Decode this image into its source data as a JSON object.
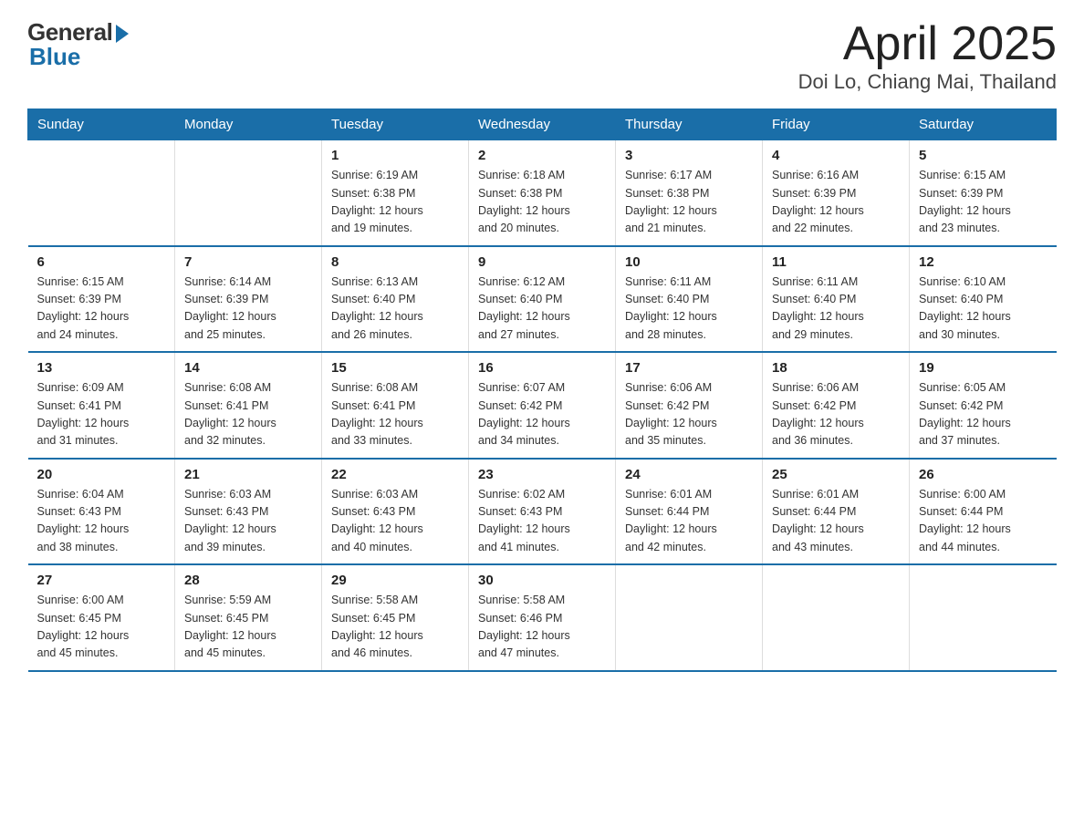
{
  "header": {
    "logo_general": "General",
    "logo_blue": "Blue",
    "title": "April 2025",
    "subtitle": "Doi Lo, Chiang Mai, Thailand"
  },
  "days_of_week": [
    "Sunday",
    "Monday",
    "Tuesday",
    "Wednesday",
    "Thursday",
    "Friday",
    "Saturday"
  ],
  "weeks": [
    [
      {
        "day": "",
        "info": ""
      },
      {
        "day": "",
        "info": ""
      },
      {
        "day": "1",
        "info": "Sunrise: 6:19 AM\nSunset: 6:38 PM\nDaylight: 12 hours\nand 19 minutes."
      },
      {
        "day": "2",
        "info": "Sunrise: 6:18 AM\nSunset: 6:38 PM\nDaylight: 12 hours\nand 20 minutes."
      },
      {
        "day": "3",
        "info": "Sunrise: 6:17 AM\nSunset: 6:38 PM\nDaylight: 12 hours\nand 21 minutes."
      },
      {
        "day": "4",
        "info": "Sunrise: 6:16 AM\nSunset: 6:39 PM\nDaylight: 12 hours\nand 22 minutes."
      },
      {
        "day": "5",
        "info": "Sunrise: 6:15 AM\nSunset: 6:39 PM\nDaylight: 12 hours\nand 23 minutes."
      }
    ],
    [
      {
        "day": "6",
        "info": "Sunrise: 6:15 AM\nSunset: 6:39 PM\nDaylight: 12 hours\nand 24 minutes."
      },
      {
        "day": "7",
        "info": "Sunrise: 6:14 AM\nSunset: 6:39 PM\nDaylight: 12 hours\nand 25 minutes."
      },
      {
        "day": "8",
        "info": "Sunrise: 6:13 AM\nSunset: 6:40 PM\nDaylight: 12 hours\nand 26 minutes."
      },
      {
        "day": "9",
        "info": "Sunrise: 6:12 AM\nSunset: 6:40 PM\nDaylight: 12 hours\nand 27 minutes."
      },
      {
        "day": "10",
        "info": "Sunrise: 6:11 AM\nSunset: 6:40 PM\nDaylight: 12 hours\nand 28 minutes."
      },
      {
        "day": "11",
        "info": "Sunrise: 6:11 AM\nSunset: 6:40 PM\nDaylight: 12 hours\nand 29 minutes."
      },
      {
        "day": "12",
        "info": "Sunrise: 6:10 AM\nSunset: 6:40 PM\nDaylight: 12 hours\nand 30 minutes."
      }
    ],
    [
      {
        "day": "13",
        "info": "Sunrise: 6:09 AM\nSunset: 6:41 PM\nDaylight: 12 hours\nand 31 minutes."
      },
      {
        "day": "14",
        "info": "Sunrise: 6:08 AM\nSunset: 6:41 PM\nDaylight: 12 hours\nand 32 minutes."
      },
      {
        "day": "15",
        "info": "Sunrise: 6:08 AM\nSunset: 6:41 PM\nDaylight: 12 hours\nand 33 minutes."
      },
      {
        "day": "16",
        "info": "Sunrise: 6:07 AM\nSunset: 6:42 PM\nDaylight: 12 hours\nand 34 minutes."
      },
      {
        "day": "17",
        "info": "Sunrise: 6:06 AM\nSunset: 6:42 PM\nDaylight: 12 hours\nand 35 minutes."
      },
      {
        "day": "18",
        "info": "Sunrise: 6:06 AM\nSunset: 6:42 PM\nDaylight: 12 hours\nand 36 minutes."
      },
      {
        "day": "19",
        "info": "Sunrise: 6:05 AM\nSunset: 6:42 PM\nDaylight: 12 hours\nand 37 minutes."
      }
    ],
    [
      {
        "day": "20",
        "info": "Sunrise: 6:04 AM\nSunset: 6:43 PM\nDaylight: 12 hours\nand 38 minutes."
      },
      {
        "day": "21",
        "info": "Sunrise: 6:03 AM\nSunset: 6:43 PM\nDaylight: 12 hours\nand 39 minutes."
      },
      {
        "day": "22",
        "info": "Sunrise: 6:03 AM\nSunset: 6:43 PM\nDaylight: 12 hours\nand 40 minutes."
      },
      {
        "day": "23",
        "info": "Sunrise: 6:02 AM\nSunset: 6:43 PM\nDaylight: 12 hours\nand 41 minutes."
      },
      {
        "day": "24",
        "info": "Sunrise: 6:01 AM\nSunset: 6:44 PM\nDaylight: 12 hours\nand 42 minutes."
      },
      {
        "day": "25",
        "info": "Sunrise: 6:01 AM\nSunset: 6:44 PM\nDaylight: 12 hours\nand 43 minutes."
      },
      {
        "day": "26",
        "info": "Sunrise: 6:00 AM\nSunset: 6:44 PM\nDaylight: 12 hours\nand 44 minutes."
      }
    ],
    [
      {
        "day": "27",
        "info": "Sunrise: 6:00 AM\nSunset: 6:45 PM\nDaylight: 12 hours\nand 45 minutes."
      },
      {
        "day": "28",
        "info": "Sunrise: 5:59 AM\nSunset: 6:45 PM\nDaylight: 12 hours\nand 45 minutes."
      },
      {
        "day": "29",
        "info": "Sunrise: 5:58 AM\nSunset: 6:45 PM\nDaylight: 12 hours\nand 46 minutes."
      },
      {
        "day": "30",
        "info": "Sunrise: 5:58 AM\nSunset: 6:46 PM\nDaylight: 12 hours\nand 47 minutes."
      },
      {
        "day": "",
        "info": ""
      },
      {
        "day": "",
        "info": ""
      },
      {
        "day": "",
        "info": ""
      }
    ]
  ]
}
